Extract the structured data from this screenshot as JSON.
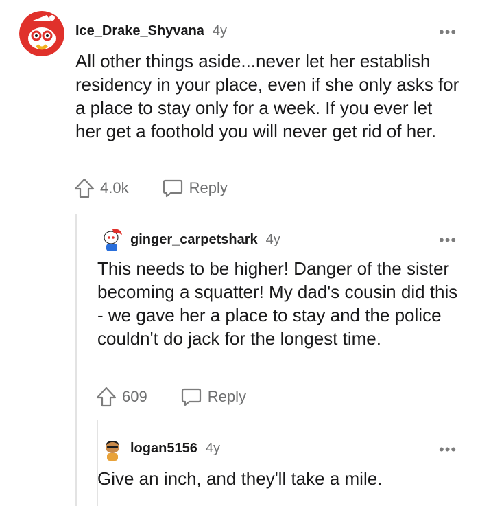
{
  "comments": [
    {
      "username": "Ice_Drake_Shyvana",
      "age": "4y",
      "body": "All other things aside...never let her establish residency in your place, even if she only asks for a place to stay only for a week. If you ever let her get a foothold you will never get rid of her.",
      "upvotes": "4.0k",
      "reply_label": "Reply",
      "avatar_icon": "snoo-avatar-icon",
      "more_icon": "more-options-icon"
    },
    {
      "username": "ginger_carpetshark",
      "age": "4y",
      "body": "This needs to be higher! Danger of the sister becoming a squatter! My dad's cousin did this - we gave her a place to stay and the police couldn't do jack for the longest time.",
      "upvotes": "609",
      "reply_label": "Reply",
      "avatar_icon": "snoo-avatar-icon",
      "more_icon": "more-options-icon"
    },
    {
      "username": "logan5156",
      "age": "4y",
      "body": "Give an inch, and they'll take a mile.",
      "avatar_icon": "snoo-avatar-icon",
      "more_icon": "more-options-icon"
    }
  ],
  "more_glyph": "•••",
  "colors": {
    "text": "#1a1a1b",
    "meta": "#6f7071",
    "thread_line": "#e3e3e3",
    "avatar_red": "#e0312b"
  }
}
